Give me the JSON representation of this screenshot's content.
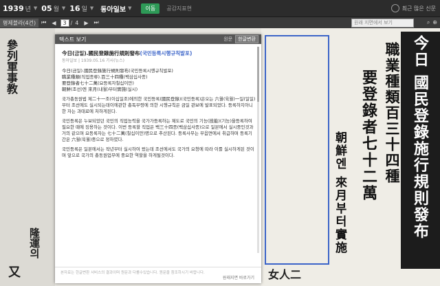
{
  "topbar": {
    "year": "1939",
    "year_unit": "년",
    "month": "05",
    "month_unit": "월",
    "day": "16",
    "day_unit": "일",
    "paper": "동아일보",
    "green_btn": "이동",
    "link": "공감지표현",
    "right_text": "최근 많은 신문"
  },
  "toolbar": {
    "left_label": "평제블라(4건)",
    "first": "⏮",
    "prev": "◀",
    "page_current": "3",
    "page_sep": "/",
    "page_total": "4",
    "next": "▶",
    "last": "⏭",
    "search_placeholder": "원래 지면에서 보기"
  },
  "panel": {
    "header": "텍스트 보기",
    "orig_label": "원문",
    "hangul_label": "한글변환",
    "title_prefix": "今日(금일).國民登錄施行規則發布",
    "title_hl": "(국민등록시행규칙발포)",
    "meta": "동아일보 | 1939.05.16 기사(뉴스)",
    "lines": [
      "今日(금일).國民登錄施行規則發布(국민등록시행규칙발포)",
      "職業種類(직업종류).百三十四種(백삼십사종)",
      "要登錄者七十二萬(요등록자칠십이만)",
      "朝鮮(조선)엔 來月(내월)부터實施(실시)"
    ],
    "para1": "국가총동원법 제二十一조(이십일조)에의한 국민등록(國民登錄)(국민등록)은오는 六월(육월)一일(일일)부터 조선에도 실시되는데이에관한 총독부령에 의한 시행규칙은 금일 관보에 발표되었다. 등록하지아니한 자는 과태료에 처하게된다.",
    "para2": "국민등록은 누보되었던 국민의 직업능력을 국가가등록하는 제도로 국민의 기능(技能)(기능)을등록하여 필요한 때에 징용하는 것이다. 이번 등록할 직업은 백三十四종(백삼십사종)으로 일본에서 실시중인것과 거의 같으며 요등록자는 七十二萬(칠십이만)명으로 추산된다. 등록사무는 부읍면에서 취급하며 등록기간은 六월(육월)중으로 정하였다.",
    "para3": "국민등록은 일본에서는 작년부터 실시하여 왔는데 조선에서도 국가의 요청에 따라 이를 실시하게된 것이며 앞으로 국가의 총동원업무에 중요한 역할을 하게될것이다.",
    "footer_note": "본자료는 한글변환 서비스의 결과이며 원문과 다를수있습니다. 원문을 참조하시기 바랍니다.",
    "footer_link": "원래지면 바로가기"
  },
  "newspaper": {
    "headline": "今日 國民登錄施行規則發布",
    "col1": "職業種類百三十四種",
    "col2": "要登錄者七十二萬",
    "col3": "朝鮮엔 來月부터實施",
    "left1": "參列軍事教",
    "left2": "隆運의",
    "left3": "又",
    "bottom1": "女人二"
  }
}
